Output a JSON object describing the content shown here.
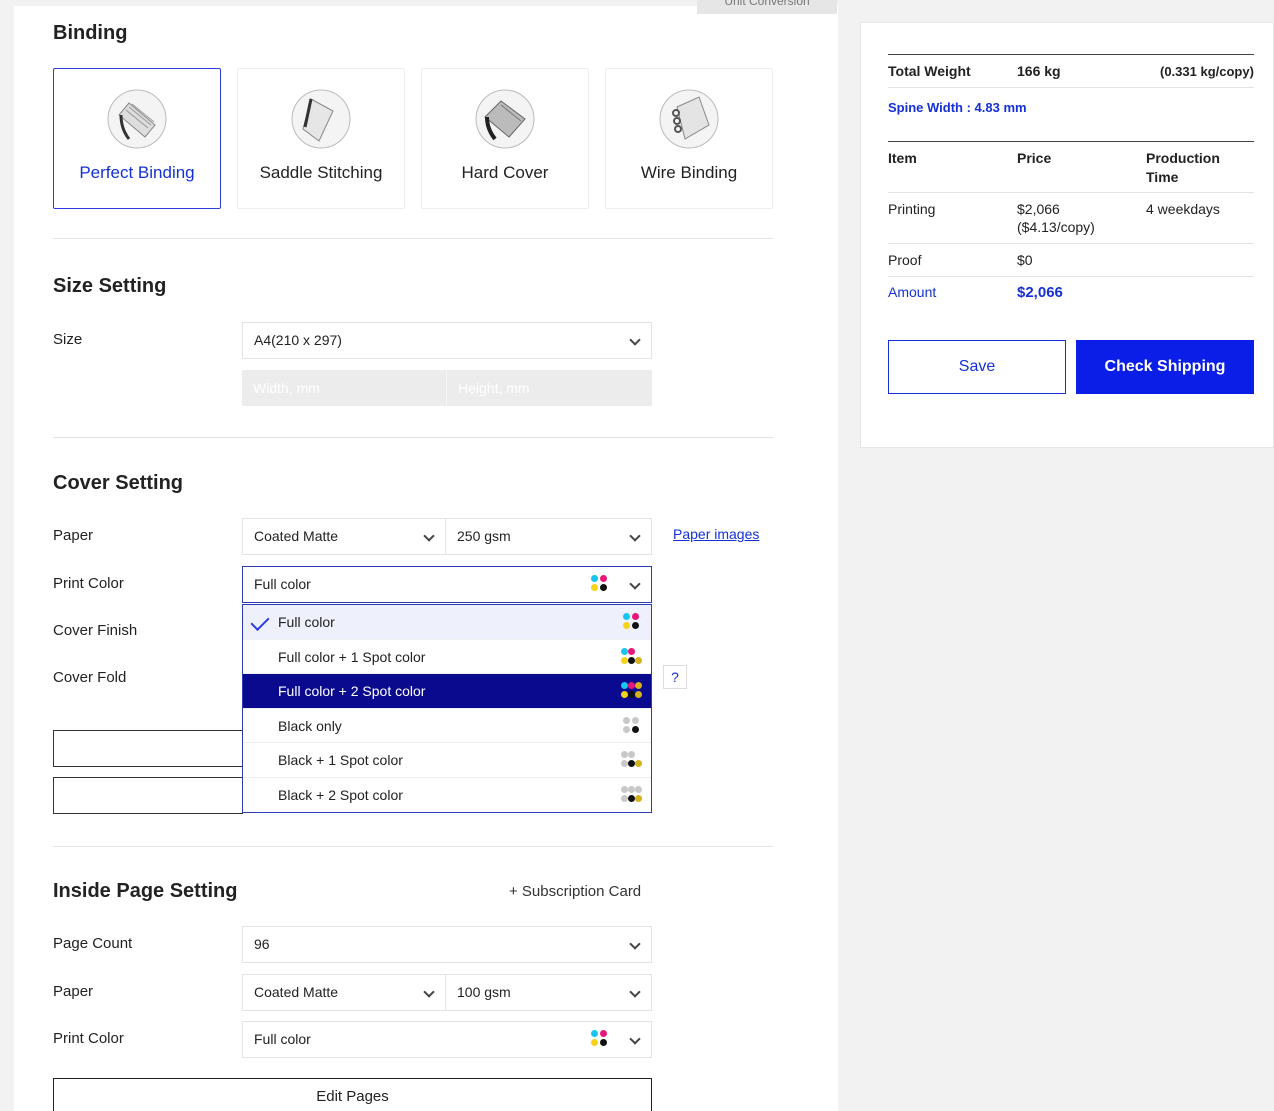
{
  "header": {
    "unit_conversion": "Unit Conversion"
  },
  "binding": {
    "title": "Binding",
    "options": [
      {
        "label": "Perfect Binding",
        "selected": true
      },
      {
        "label": "Saddle Stitching",
        "selected": false
      },
      {
        "label": "Hard Cover",
        "selected": false
      },
      {
        "label": "Wire Binding",
        "selected": false
      }
    ]
  },
  "size": {
    "title": "Size Setting",
    "label": "Size",
    "value": "A4(210 x 297)",
    "width_placeholder": "Width, mm",
    "height_placeholder": "Height, mm"
  },
  "cover": {
    "title": "Cover Setting",
    "paper_label": "Paper",
    "paper_value": "Coated Matte",
    "weight_value": "250 gsm",
    "paper_images_link": "Paper images",
    "print_color_label": "Print Color",
    "print_color_value": "Full color",
    "finish_label": "Cover Finish",
    "fold_label": "Cover Fold",
    "help": "?"
  },
  "print_color_dropdown": {
    "options": [
      {
        "label": "Full color",
        "state": "checked"
      },
      {
        "label": "Full color + 1 Spot color",
        "state": "normal"
      },
      {
        "label": "Full color + 2 Spot color",
        "state": "hover"
      },
      {
        "label": "Black only",
        "state": "normal"
      },
      {
        "label": "Black + 1 Spot color",
        "state": "normal"
      },
      {
        "label": "Black + 2 Spot color",
        "state": "normal"
      }
    ]
  },
  "inside": {
    "title": "Inside Page Setting",
    "subscription_card": "+ Subscription Card",
    "page_count_label": "Page Count",
    "page_count_value": "96",
    "paper_label": "Paper",
    "paper_value": "Coated Matte",
    "weight_value": "100 gsm",
    "print_color_label": "Print Color",
    "print_color_value": "Full color",
    "edit_pages": "Edit Pages"
  },
  "summary": {
    "total_weight_label": "Total Weight",
    "total_weight_value": "166 kg",
    "per_copy_weight": "(0.331 kg/copy)",
    "spine_width": "Spine Width : 4.83 mm",
    "col_item": "Item",
    "col_price": "Price",
    "col_production_1": "Production",
    "col_production_2": "Time",
    "rows": [
      {
        "item": "Printing",
        "price": "$2,066",
        "price_sub": "($4.13/copy)",
        "time": "4 weekdays"
      },
      {
        "item": "Proof",
        "price": "$0",
        "price_sub": "",
        "time": ""
      }
    ],
    "amount_label": "Amount",
    "amount_value": "$2,066",
    "save_label": "Save",
    "check_shipping_label": "Check Shipping"
  },
  "colors": {
    "accent": "#1530d8",
    "hover": "#0a0a8e",
    "cyan": "#19c4f0",
    "magenta": "#e8157a",
    "yellow": "#f7d21a",
    "black": "#111111",
    "gray": "#c8c8c8",
    "spot": "#d2b21e"
  }
}
